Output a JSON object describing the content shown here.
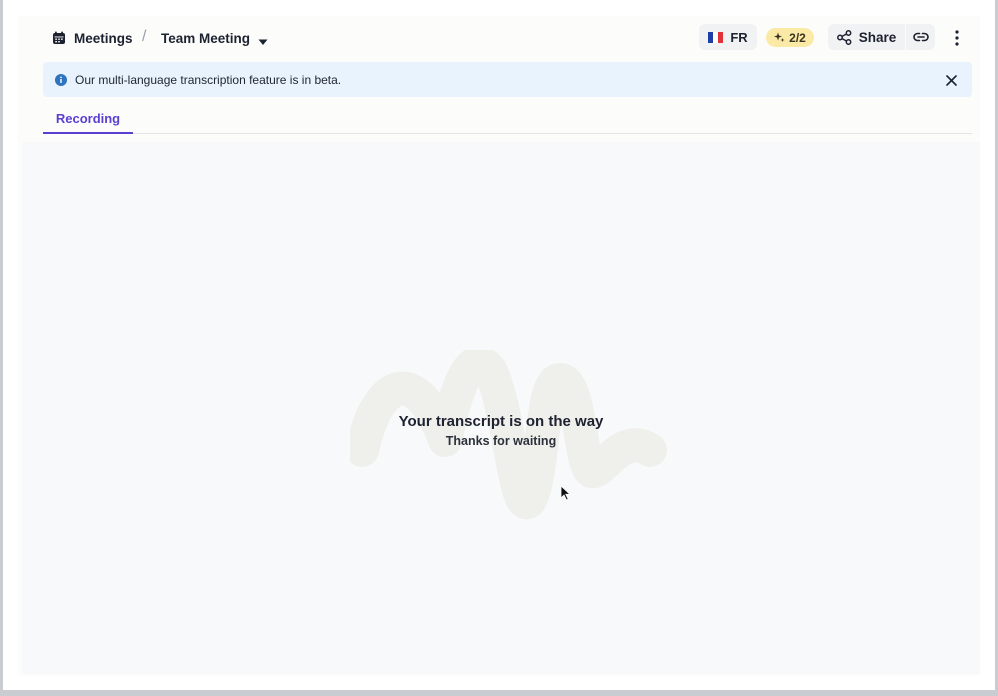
{
  "breadcrumb": {
    "root_label": "Meetings",
    "separator": "/",
    "current_label": "Team Meeting"
  },
  "header": {
    "language": {
      "code": "FR",
      "flag_colors": [
        "#1f3fa8",
        "#ffffff",
        "#e0333a"
      ]
    },
    "credits": "2/2",
    "share_label": "Share"
  },
  "banner": {
    "text": "Our multi-language transcription feature is in beta."
  },
  "tabs": [
    {
      "label": "Recording",
      "active": true
    }
  ],
  "empty_state": {
    "title": "Your transcript is on the way",
    "subtitle": "Thanks for waiting"
  },
  "colors": {
    "accent": "#5b3fd1",
    "banner_bg": "#e8f3fd",
    "credits_bg": "#fbe9a6"
  },
  "icons": [
    "calendar-icon",
    "chevron-down-icon",
    "sparkle-icon",
    "share-icon",
    "link-icon",
    "more-vertical-icon",
    "info-icon",
    "close-icon"
  ]
}
